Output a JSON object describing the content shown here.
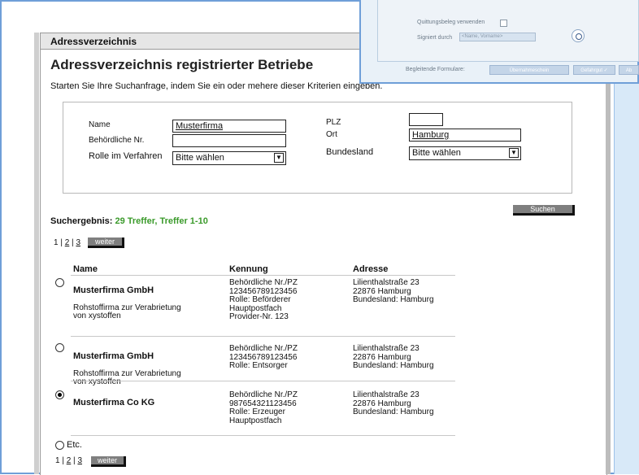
{
  "panel": {
    "title": "Adressverzeichnis"
  },
  "page": {
    "title": "Adressverzeichnis registrierter Betriebe",
    "intro": "Starten Sie Ihre Suchanfrage, indem Sie ein oder mehere dieser Kriterien eingeben."
  },
  "search": {
    "name_label": "Name",
    "name_value": "Musterfirma",
    "behoerd_label": "Behördliche Nr.",
    "behoerd_value": "",
    "rolle_label": "Rolle im Verfahren",
    "rolle_value": "Bitte wählen",
    "plz_label": "PLZ",
    "plz_value": "",
    "ort_label": "Ort",
    "ort_value": "Hamburg",
    "bundesland_label": "Bundesland",
    "bundesland_value": "Bitte wählen",
    "submit_label": "Suchen"
  },
  "results": {
    "heading_label": "Suchergebnis:",
    "summary": "29 Treffer, Treffer 1-10",
    "pager": {
      "current": "1",
      "pages": [
        "2",
        "3"
      ],
      "next_label": "weiter"
    },
    "columns": [
      "Name",
      "Kennung",
      "Adresse"
    ],
    "rows": [
      {
        "name": "Musterfirma GmbH",
        "desc": "Rohstoffirma zur Verabrietung\nvon xystoffen",
        "kennung": "Behördliche Nr./PZ\n123456789123456\nRolle: Beförderer\nHauptpostfach\nProvider-Nr. 123",
        "adresse": "Lilienthalstraße 23\n22876 Hamburg\nBundesland: Hamburg",
        "selected": false
      },
      {
        "name": "Musterfirma GmbH",
        "desc": "Rohstoffirma zur Verabrietung\nvon xystoffen",
        "kennung": "Behördliche Nr./PZ\n123456789123456\nRolle: Entsorger",
        "adresse": "Lilienthalstraße 23\n22876 Hamburg\nBundesland: Hamburg",
        "selected": false
      },
      {
        "name": "Musterfirma Co KG",
        "desc": "",
        "kennung": "Behördliche Nr./PZ\n987654321123456\nRolle: Erzeuger\nHauptpostfach",
        "adresse": "Lilienthalstraße 23\n22876 Hamburg\nBundesland: Hamburg",
        "selected": true
      }
    ],
    "etc_label": "Etc."
  },
  "overlay": {
    "quittung_label": "Quittungsbeleg verwenden",
    "signiert_label": "Signiert durch",
    "signiert_placeholder": "<Name, Vorname>",
    "formulare_label": "Begleitende Formulare:",
    "buttons": [
      "Übernahmeschein",
      "Gefahrgut ✓",
      "Ab"
    ]
  },
  "colors": {
    "accent_blue": "#6f9fd8",
    "green_text": "#3a9a2a",
    "button_gray": "#7f7f7f"
  }
}
